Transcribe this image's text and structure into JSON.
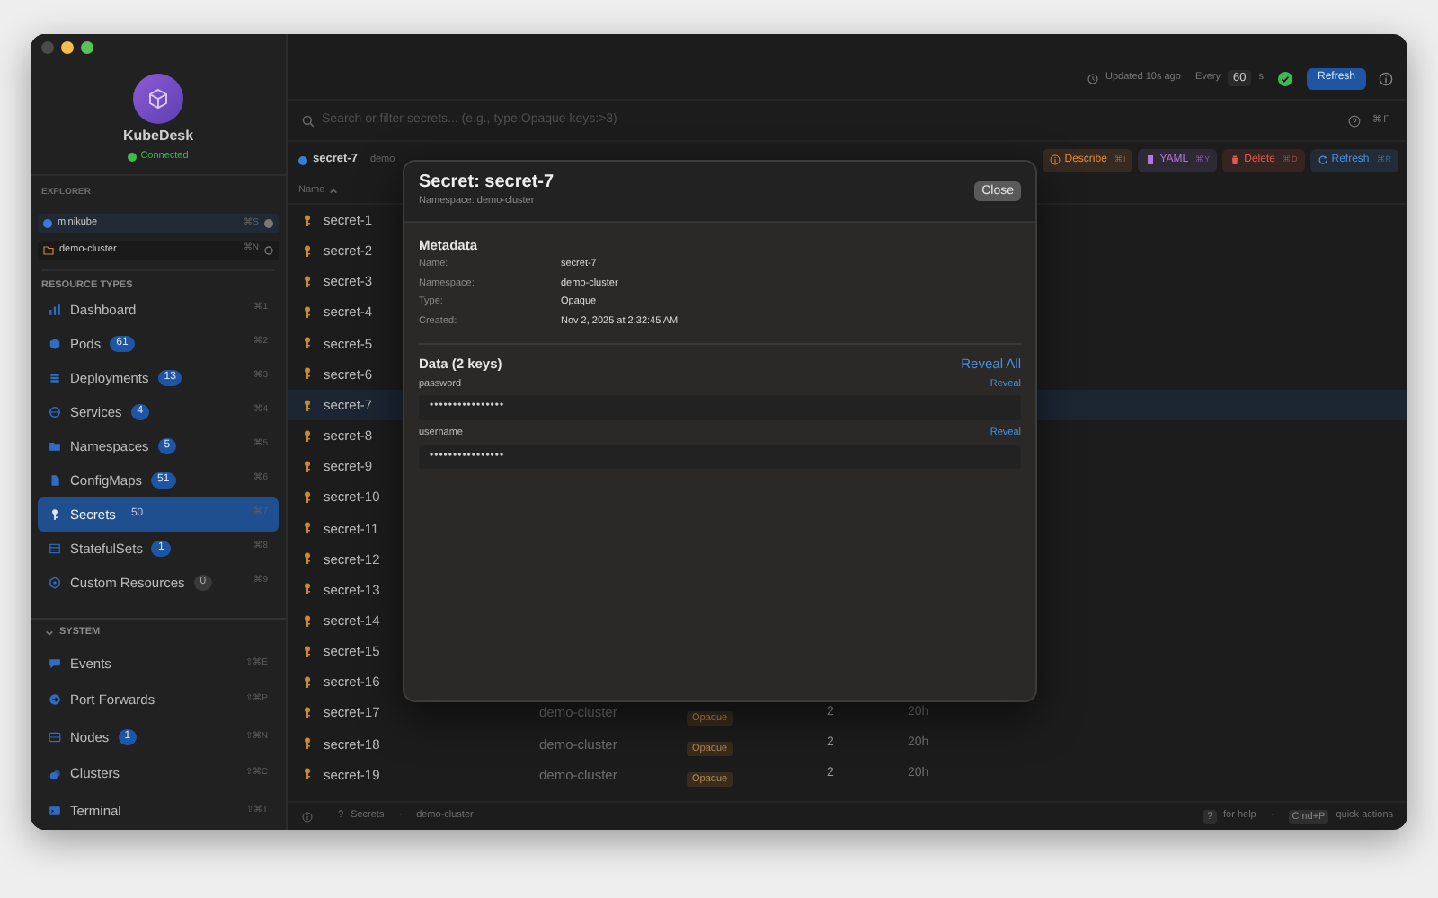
{
  "app": {
    "name": "KubeDesk",
    "status": "Connected",
    "connected": true
  },
  "explorer": {
    "title": "EXPLORER",
    "contexts": [
      {
        "name": "minikube",
        "kind": "cluster",
        "shortcut": "⌘S",
        "selected": true
      },
      {
        "name": "demo-cluster",
        "kind": "namespace",
        "shortcut": "⌘N",
        "selected": false
      }
    ]
  },
  "resource_types": {
    "title": "RESOURCE TYPES",
    "items": [
      {
        "label": "Dashboard",
        "shortcut": "⌘1",
        "selected": false
      },
      {
        "label": "Pods",
        "badge": "61",
        "shortcut": "⌘2",
        "selected": false
      },
      {
        "label": "Deployments",
        "badge": "13",
        "shortcut": "⌘3",
        "selected": false
      },
      {
        "label": "Services",
        "badge": "4",
        "shortcut": "⌘4",
        "selected": false
      },
      {
        "label": "Namespaces",
        "badge": "5",
        "shortcut": "⌘5",
        "selected": false
      },
      {
        "label": "ConfigMaps",
        "badge": "51",
        "shortcut": "⌘6",
        "selected": false
      },
      {
        "label": "Secrets",
        "badge": "50",
        "shortcut": "⌘7",
        "selected": true
      },
      {
        "label": "StatefulSets",
        "badge": "1",
        "shortcut": "⌘8",
        "selected": false
      },
      {
        "label": "Custom Resources",
        "badge": "0",
        "shortcut": "⌘9",
        "selected": false
      }
    ]
  },
  "system": {
    "title": "SYSTEM",
    "expanded": true,
    "items": [
      {
        "label": "Events",
        "shortcut": "⇧⌘E",
        "selected": false
      },
      {
        "label": "Port Forwards",
        "shortcut": "⇧⌘P",
        "selected": false
      },
      {
        "label": "Nodes",
        "badge": "1",
        "shortcut": "⇧⌘N",
        "selected": false
      },
      {
        "label": "Clusters",
        "shortcut": "⇧⌘C",
        "selected": false
      },
      {
        "label": "Terminal",
        "shortcut": "⇧⌘T",
        "selected": false
      }
    ]
  },
  "toolbar": {
    "updated": "Updated 10s ago",
    "every_label": "Every",
    "interval": "60",
    "unit": "s",
    "auto_refresh": true,
    "refresh_button": "Refresh"
  },
  "search": {
    "placeholder": "Search or filter secrets... (e.g., type:Opaque keys:>3)",
    "shortcut": "⌘F"
  },
  "selection": {
    "name": "secret-7",
    "namespace": "demo",
    "actions": [
      {
        "label": "Describe",
        "shortcut": "⌘I",
        "color": "#e8893a"
      },
      {
        "label": "YAML",
        "shortcut": "⌘Y",
        "color": "#b07ad8"
      },
      {
        "label": "Delete",
        "shortcut": "⌘D",
        "color": "#e05a4e"
      },
      {
        "label": "Refresh",
        "shortcut": "⌘R",
        "color": "#4a8fe0"
      }
    ]
  },
  "table": {
    "columns": [
      {
        "label": "Name",
        "sort_ascending": true
      }
    ],
    "rows": [
      {
        "name": "secret-1",
        "selected": false
      },
      {
        "name": "secret-2",
        "selected": false
      },
      {
        "name": "secret-3",
        "selected": false
      },
      {
        "name": "secret-4",
        "selected": false
      },
      {
        "name": "secret-5",
        "selected": false
      },
      {
        "name": "secret-6",
        "selected": false
      },
      {
        "name": "secret-7",
        "selected": true
      },
      {
        "name": "secret-8",
        "selected": false
      },
      {
        "name": "secret-9",
        "selected": false
      },
      {
        "name": "secret-10",
        "selected": false
      },
      {
        "name": "secret-11",
        "selected": false
      },
      {
        "name": "secret-12",
        "selected": false
      },
      {
        "name": "secret-13",
        "selected": false
      },
      {
        "name": "secret-14",
        "selected": false
      },
      {
        "name": "secret-15",
        "selected": false
      },
      {
        "name": "secret-16",
        "selected": false
      },
      {
        "name": "secret-17",
        "namespace": "demo-cluster",
        "type": "Opaque",
        "keys": "2",
        "age": "20h",
        "selected": false
      },
      {
        "name": "secret-18",
        "namespace": "demo-cluster",
        "type": "Opaque",
        "keys": "2",
        "age": "20h",
        "selected": false
      },
      {
        "name": "secret-19",
        "namespace": "demo-cluster",
        "type": "Opaque",
        "keys": "2",
        "age": "20h",
        "selected": false
      }
    ]
  },
  "modal": {
    "title": "Secret: secret-7",
    "subtitle": "Namespace: demo-cluster",
    "close": "Close",
    "metadata": {
      "title": "Metadata",
      "fields": [
        {
          "label": "Name:",
          "value": "secret-7"
        },
        {
          "label": "Namespace:",
          "value": "demo-cluster"
        },
        {
          "label": "Type:",
          "value": "Opaque"
        },
        {
          "label": "Created:",
          "value": "Nov 2, 2025 at 2:32:45 AM"
        }
      ]
    },
    "data": {
      "title": "Data (2 keys)",
      "reveal_all": "Reveal All",
      "keys": [
        {
          "name": "password",
          "reveal": "Reveal",
          "value": "••••••••••••••••"
        },
        {
          "name": "username",
          "reveal": "Reveal",
          "value": "••••••••••••••••"
        }
      ]
    }
  },
  "status_bar": {
    "left": [
      {
        "kind": "text",
        "text": "?"
      },
      {
        "kind": "text",
        "text": "Secrets"
      },
      {
        "kind": "sep",
        "text": "·"
      },
      {
        "kind": "text",
        "text": "demo-cluster"
      }
    ],
    "right": [
      {
        "kind": "key",
        "text": "?"
      },
      {
        "kind": "text",
        "text": "for help"
      },
      {
        "kind": "sep",
        "text": "·"
      },
      {
        "kind": "key",
        "text": "Cmd+P"
      },
      {
        "kind": "text",
        "text": "quick actions"
      }
    ]
  }
}
